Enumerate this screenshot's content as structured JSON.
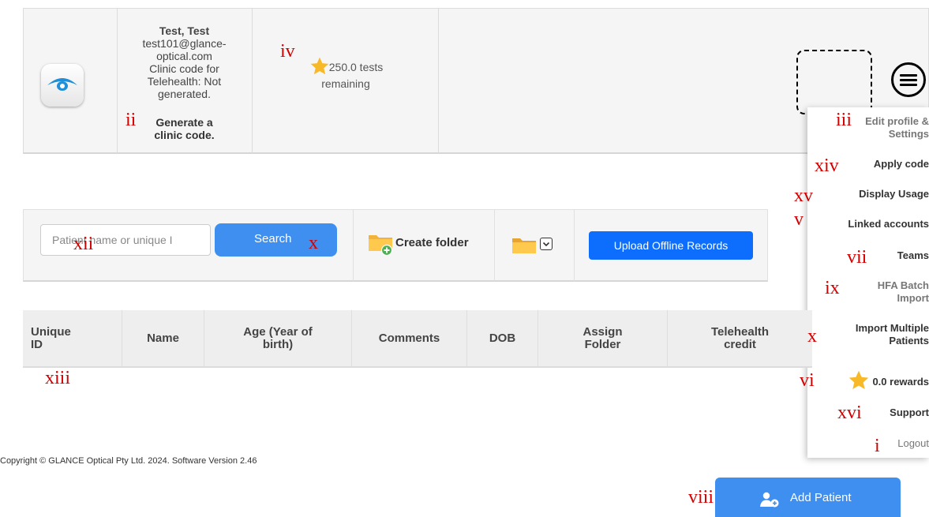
{
  "profile": {
    "name": "Test, Test",
    "email_line1": "test101@glance-",
    "email_line2": "optical.com",
    "clinic_line1": "Clinic code for",
    "clinic_line2": "Telehealth: Not",
    "clinic_line3": "generated.",
    "generate_line1": "Generate a",
    "generate_line2": "clinic code.",
    "tests_line1": "250.0 tests",
    "tests_line2": "remaining"
  },
  "menu": {
    "edit_line1": "Edit profile &",
    "edit_line2": "Settings",
    "apply_code": "Apply code",
    "display_usage": "Display Usage",
    "linked_accounts": "Linked accounts",
    "teams": "Teams",
    "hfa_line1": "HFA Batch",
    "hfa_line2": "Import",
    "import_line1": "Import Multiple",
    "import_line2": "Patients",
    "rewards": "0.0 rewards",
    "support": "Support",
    "logout": "Logout"
  },
  "toolbar": {
    "search_placeholder": "Patient name or unique I",
    "search_label": "Search",
    "create_folder": "Create folder",
    "upload_label": "Upload Offline Records"
  },
  "table": {
    "headers": [
      {
        "l1": "Unique",
        "l2": "ID"
      },
      {
        "l1": "Name",
        "l2": ""
      },
      {
        "l1": "Age (Year of",
        "l2": "birth)"
      },
      {
        "l1": "Comments",
        "l2": ""
      },
      {
        "l1": "DOB",
        "l2": ""
      },
      {
        "l1": "Assign",
        "l2": "Folder"
      },
      {
        "l1": "Telehealth",
        "l2": "credit"
      }
    ]
  },
  "footer": {
    "copyright": "Copyright © GLANCE Optical Pty Ltd. 2024. Software Version 2.46",
    "add_patient": "Add Patient"
  },
  "annotations": {
    "i": "i",
    "ii": "ii",
    "iii": "iii",
    "iv": "iv",
    "v": "v",
    "vi": "vi",
    "vii": "vii",
    "viii": "viii",
    "ix": "ix",
    "x": "x",
    "xii": "xii",
    "xiii": "xiii",
    "xiv": "xiv",
    "xv": "xv",
    "xvi": "xvi"
  },
  "colors": {
    "primary_button": "#3f8ff1",
    "upload_button": "#0d6efd",
    "annotation_red": "#d40000",
    "star": "#f7b928"
  },
  "icons": [
    "eye-logo-icon",
    "star-icon",
    "hamburger-menu-icon",
    "folder-add-icon",
    "folder-icon",
    "chevron-down-icon",
    "add-user-icon"
  ]
}
